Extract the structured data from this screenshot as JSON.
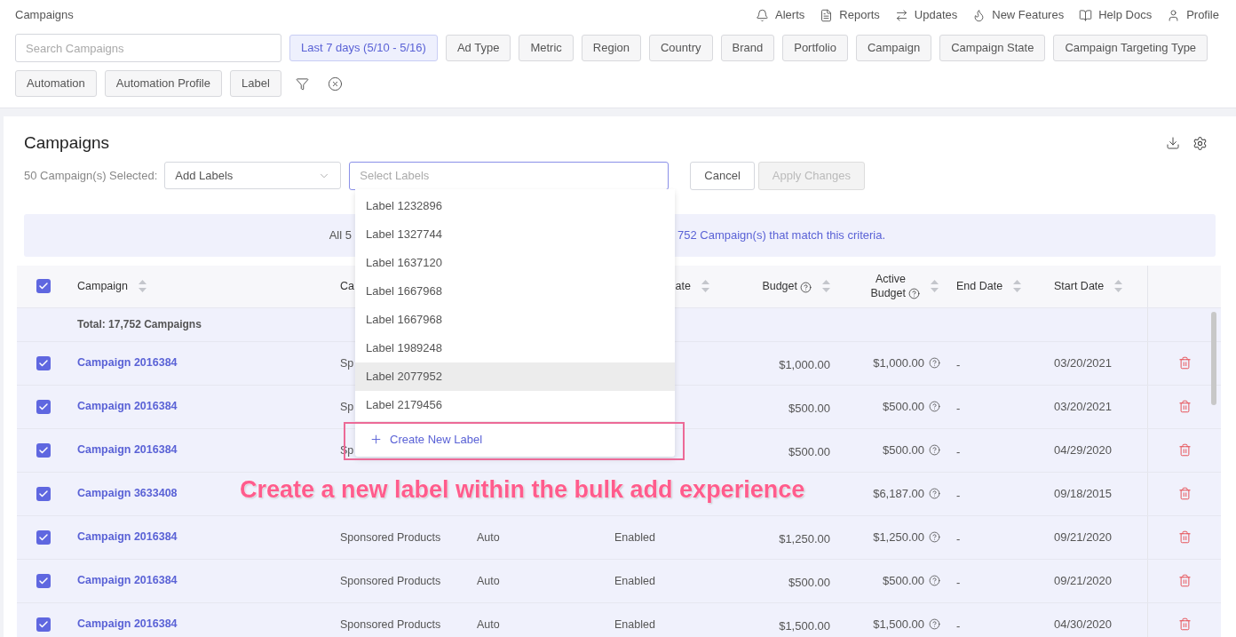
{
  "header": {
    "title": "Campaigns",
    "nav": [
      {
        "kind": "bell",
        "label": "Alerts"
      },
      {
        "kind": "document",
        "label": "Reports"
      },
      {
        "kind": "arrows",
        "label": "Updates"
      },
      {
        "kind": "flame",
        "label": "New Features"
      },
      {
        "kind": "book",
        "label": "Help Docs"
      },
      {
        "kind": "user",
        "label": "Profile"
      }
    ]
  },
  "filters": {
    "search": {
      "placeholder": "Search Campaigns"
    },
    "chips": [
      {
        "label": "Last 7 days (5/10 - 5/16)",
        "selected": true
      },
      {
        "label": "Ad Type",
        "selected": false
      },
      {
        "label": "Metric",
        "selected": false
      },
      {
        "label": "Region",
        "selected": false
      },
      {
        "label": "Country",
        "selected": false
      },
      {
        "label": "Brand",
        "selected": false
      },
      {
        "label": "Portfolio",
        "selected": false
      },
      {
        "label": "Campaign",
        "selected": false
      },
      {
        "label": "Campaign State",
        "selected": false
      },
      {
        "label": "Campaign Targeting Type",
        "selected": false
      },
      {
        "label": "Automation",
        "selected": false
      },
      {
        "label": "Automation Profile",
        "selected": false
      },
      {
        "label": "Label",
        "selected": false
      }
    ]
  },
  "panel": {
    "title": "Campaigns",
    "selection_count": "50 Campaign(s) Selected:",
    "action_select": {
      "value": "Add Labels"
    },
    "label_select": {
      "placeholder": "Select Labels"
    },
    "cancel_button": {
      "label": "Cancel",
      "disabled": false
    },
    "apply_button": {
      "label": "Apply Changes",
      "disabled": true
    }
  },
  "dropdown": {
    "options": [
      {
        "label": "Label 1232896",
        "highlighted": false
      },
      {
        "label": "Label 1327744",
        "highlighted": false
      },
      {
        "label": "Label 1637120",
        "highlighted": false
      },
      {
        "label": "Label 1667968",
        "highlighted": false
      },
      {
        "label": "Label 1667968",
        "highlighted": false
      },
      {
        "label": "Label 1989248",
        "highlighted": false
      },
      {
        "label": "Label 2077952",
        "highlighted": true
      },
      {
        "label": "Label 2179456",
        "highlighted": false
      }
    ],
    "create": "Create New Label"
  },
  "banner": {
    "left_text": "All 5",
    "right_text": "752 Campaign(s) that match this criteria."
  },
  "table": {
    "select_all_checked": true,
    "columns": [
      {
        "label": "Campaign",
        "sortable": true,
        "help": false
      },
      {
        "label": "Ca"
      },
      {
        "label": "ate",
        "sortable": true,
        "help": false
      },
      {
        "label": "Budget",
        "sortable": true,
        "help": true
      },
      {
        "label": "Active Budget",
        "sortable": true,
        "help": true
      },
      {
        "label": "End Date",
        "sortable": true,
        "help": false
      },
      {
        "label": "Start Date",
        "sortable": true,
        "help": false
      }
    ],
    "total": "Total: 17,752 Campaigns",
    "rows": [
      {
        "checked": true,
        "campaign": "Campaign 2016384",
        "column_2": "Sp",
        "budget": "$1,000.00",
        "active_budget": "$1,000.00",
        "end_date": "-",
        "start_date": "03/20/2021"
      },
      {
        "checked": true,
        "campaign": "Campaign 2016384",
        "column_2": "Sp",
        "budget": "$500.00",
        "active_budget": "$500.00",
        "end_date": "-",
        "start_date": "03/20/2021"
      },
      {
        "checked": true,
        "campaign": "Campaign 2016384",
        "column_2": "Sp",
        "budget": "$500.00",
        "active_budget": "$500.00",
        "end_date": "-",
        "start_date": "04/29/2020"
      },
      {
        "checked": true,
        "campaign": "Campaign 3633408",
        "active_budget": "$6,187.00",
        "end_date": "-",
        "start_date": "09/18/2015"
      },
      {
        "checked": true,
        "campaign": "Campaign 2016384",
        "column_2": "Sponsored Products",
        "column_3": "Auto",
        "state": "Enabled",
        "budget": "$1,250.00",
        "active_budget": "$1,250.00",
        "end_date": "-",
        "start_date": "09/21/2020"
      },
      {
        "checked": true,
        "campaign": "Campaign 2016384",
        "column_2": "Sponsored Products",
        "column_3": "Auto",
        "state": "Enabled",
        "budget": "$500.00",
        "active_budget": "$500.00",
        "end_date": "-",
        "start_date": "09/21/2020"
      },
      {
        "checked": true,
        "campaign": "Campaign 2016384",
        "column_2": "Sponsored Products",
        "column_3": "Auto",
        "state": "Enabled",
        "budget": "$1,500.00",
        "active_budget": "$1,500.00",
        "end_date": "-",
        "start_date": "04/30/2020"
      }
    ]
  },
  "annotation": {
    "text": "Create a new label within the bulk add experience"
  }
}
